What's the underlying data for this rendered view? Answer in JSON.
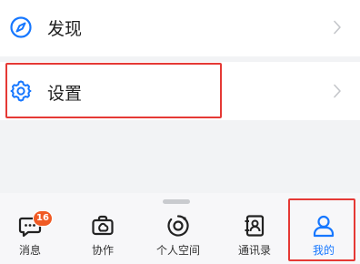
{
  "menu": {
    "discover": {
      "label": "发现",
      "icon": "compass-icon"
    },
    "settings": {
      "label": "设置",
      "icon": "gear-icon"
    }
  },
  "tabbar": {
    "items": [
      {
        "label": "消息",
        "icon": "chat-bubble-icon",
        "badge": "16",
        "active": false
      },
      {
        "label": "协作",
        "icon": "collaboration-bag-icon",
        "active": false
      },
      {
        "label": "个人空间",
        "icon": "personal-space-icon",
        "active": false
      },
      {
        "label": "通讯录",
        "icon": "contacts-book-icon",
        "active": false
      },
      {
        "label": "我的",
        "icon": "person-icon",
        "active": true
      }
    ]
  },
  "colors": {
    "accent": "#1677ff",
    "highlight": "#e53935",
    "badge": "#f05a24",
    "background": "#f2f3f5"
  }
}
